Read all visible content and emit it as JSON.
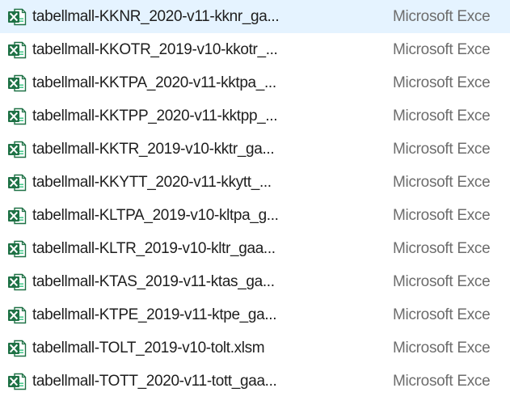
{
  "colors": {
    "excel_green": "#1e7145",
    "excel_green_light": "#33c481",
    "name_text": "#1e1e1e",
    "type_text": "#6d6d6d"
  },
  "file_icon": "excel-file-icon",
  "files": [
    {
      "name": "tabellmall-KKNR_2020-v11-kknr_ga...",
      "type": "Microsoft Exce"
    },
    {
      "name": "tabellmall-KKOTR_2019-v10-kkotr_...",
      "type": "Microsoft Exce"
    },
    {
      "name": "tabellmall-KKTPA_2020-v11-kktpa_...",
      "type": "Microsoft Exce"
    },
    {
      "name": "tabellmall-KKTPP_2020-v11-kktpp_...",
      "type": "Microsoft Exce"
    },
    {
      "name": "tabellmall-KKTR_2019-v10-kktr_ga...",
      "type": "Microsoft Exce"
    },
    {
      "name": "tabellmall-KKYTT_2020-v11-kkytt_...",
      "type": "Microsoft Exce"
    },
    {
      "name": "tabellmall-KLTPA_2019-v10-kltpa_g...",
      "type": "Microsoft Exce"
    },
    {
      "name": "tabellmall-KLTR_2019-v10-kltr_gaa...",
      "type": "Microsoft Exce"
    },
    {
      "name": "tabellmall-KTAS_2019-v11-ktas_ga...",
      "type": "Microsoft Exce"
    },
    {
      "name": "tabellmall-KTPE_2019-v11-ktpe_ga...",
      "type": "Microsoft Exce"
    },
    {
      "name": "tabellmall-TOLT_2019-v10-tolt.xlsm",
      "type": "Microsoft Exce"
    },
    {
      "name": "tabellmall-TOTT_2020-v11-tott_gaa...",
      "type": "Microsoft Exce"
    }
  ]
}
